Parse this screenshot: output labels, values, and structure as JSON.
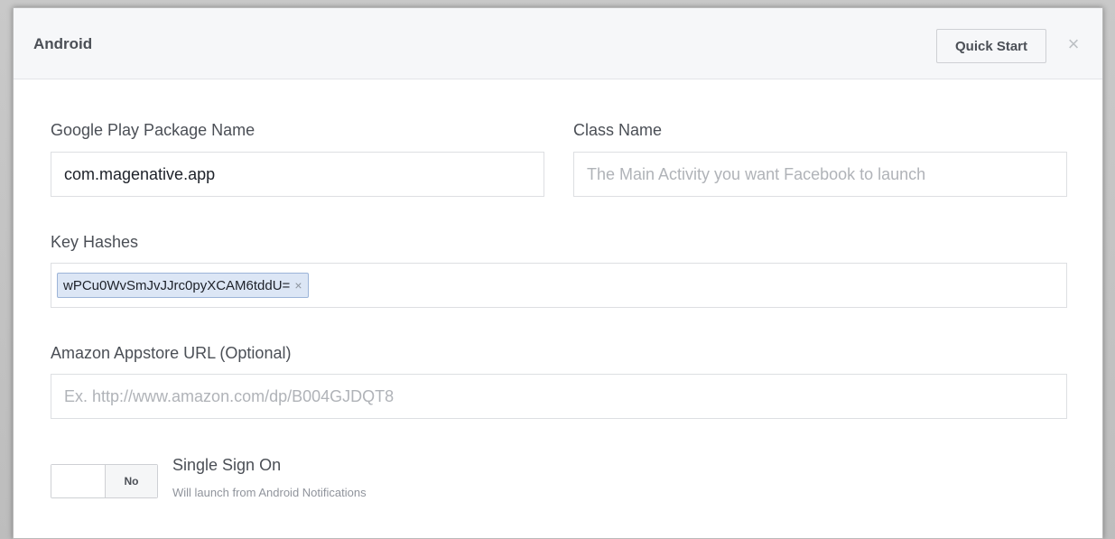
{
  "header": {
    "title": "Android",
    "quick_start_label": "Quick Start",
    "close_glyph": "×"
  },
  "fields": {
    "package_name": {
      "label": "Google Play Package Name",
      "value": "com.magenative.app"
    },
    "class_name": {
      "label": "Class Name",
      "placeholder": "The Main Activity you want Facebook to launch"
    },
    "key_hashes": {
      "label": "Key Hashes",
      "tokens": [
        "wPCu0WvSmJvJJrc0pyXCAM6tddU="
      ],
      "remove_glyph": "×"
    },
    "amazon_url": {
      "label": "Amazon Appstore URL (Optional)",
      "placeholder": "Ex. http://www.amazon.com/dp/B004GJDQT8"
    }
  },
  "single_sign_on": {
    "toggle_state": "No",
    "title": "Single Sign On",
    "description": "Will launch from Android Notifications"
  },
  "colors": {
    "header_bg": "#f6f7f9",
    "text_primary": "#4b4f56",
    "placeholder": "#b0b3b8",
    "token_border": "#9cb4d8"
  }
}
